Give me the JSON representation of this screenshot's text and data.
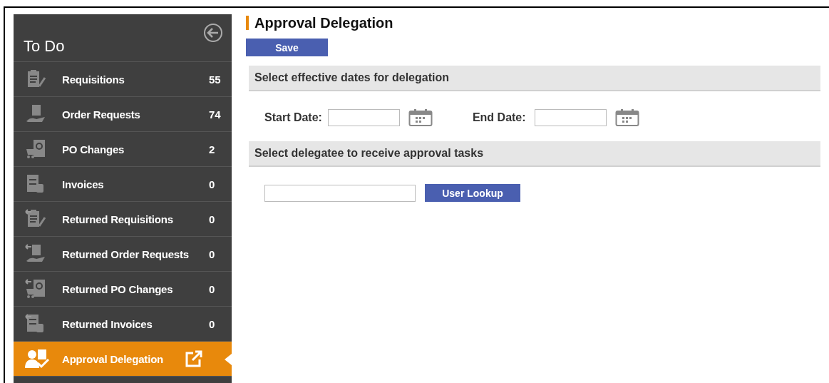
{
  "sidebar": {
    "title": "To Do",
    "items": [
      {
        "label": "Requisitions",
        "count": "55",
        "selected": false
      },
      {
        "label": "Order Requests",
        "count": "74",
        "selected": false
      },
      {
        "label": "PO Changes",
        "count": "2",
        "selected": false
      },
      {
        "label": "Invoices",
        "count": "0",
        "selected": false
      },
      {
        "label": "Returned Requisitions",
        "count": "0",
        "selected": false
      },
      {
        "label": "Returned Order Requests",
        "count": "0",
        "selected": false
      },
      {
        "label": "Returned PO Changes",
        "count": "0",
        "selected": false
      },
      {
        "label": "Returned Invoices",
        "count": "0",
        "selected": false
      },
      {
        "label": "Approval Delegation",
        "selected": true
      }
    ]
  },
  "page": {
    "title": "Approval Delegation",
    "save_button": "Save",
    "dates_section": {
      "heading": "Select effective dates for delegation",
      "start_label": "Start Date:",
      "end_label": "End Date:"
    },
    "delegatee_section": {
      "heading": "Select delegatee to receive approval tasks",
      "lookup_button": "User Lookup"
    }
  }
}
